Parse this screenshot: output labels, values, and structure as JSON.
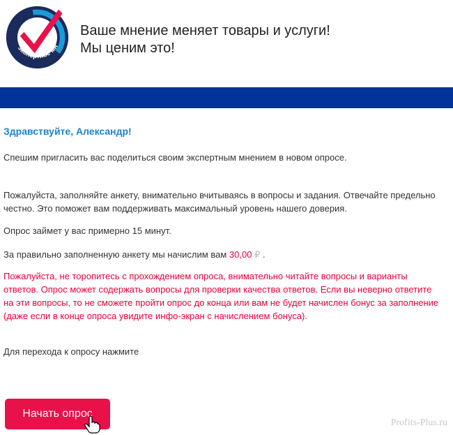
{
  "header": {
    "logo_text": "экспертное мнение",
    "tagline_line1": "Ваше мнение меняет товары и услуги!",
    "tagline_line2": "Мы ценим это!"
  },
  "colors": {
    "brand_blue": "#003399",
    "accent_red": "#e5003b",
    "greeting_blue": "#1a84c7"
  },
  "email": {
    "greeting": "Здравствуйте, Александр!",
    "invite": "Спешим пригласить вас поделиться своим экспертным мнением в новом опросе.",
    "instructions": "Пожалуйста, заполняйте анкету, внимательно вчитываясь в вопросы и задания. Отвечайте предельно честно. Это поможет вам поддерживать максимальный уровень нашего доверия.",
    "duration": "Опрос займет у вас примерно 15 минут.",
    "reward_prefix": "За правильно заполненную анкету мы начислим вам",
    "reward_amount": "30,00",
    "reward_currency": "₽",
    "reward_suffix": ".",
    "warning": "Пожалуйста, не торопитесь с прохождением опроса, внимательно читайте вопросы и варианты ответов. Опрос может содержать вопросы для проверки качества ответов. Если вы неверно ответите на эти вопросы, то не сможете пройти опрос до конца или вам не будет начислен бонус за заполнение (даже если в конце опроса увидите инфо-экран с начислением бонуса).",
    "cta_text": "Для перехода к опросу нажмите",
    "button_label": "Начать опрос"
  },
  "watermark": "Profits-Plus.ru",
  "icons": [
    "checkmark-logo-icon",
    "hand-cursor-icon"
  ]
}
